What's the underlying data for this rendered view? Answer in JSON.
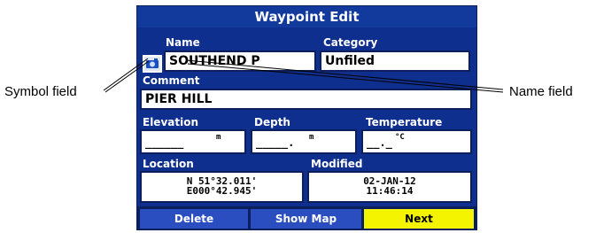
{
  "title": "Waypoint Edit",
  "labels": {
    "name": "Name",
    "category": "Category",
    "comment": "Comment",
    "elevation": "Elevation",
    "depth": "Depth",
    "temperature": "Temperature",
    "location": "Location",
    "modified": "Modified"
  },
  "values": {
    "name": "SOUTHEND P",
    "category": "Unfiled",
    "comment": "PIER HILL",
    "elevation": "______",
    "elevation_unit": "m",
    "depth": "_____.",
    "depth_unit": "m",
    "temperature": "__._",
    "temperature_unit": "°C",
    "location_lat": "N  51°32.011'",
    "location_lon": "E000°42.945'",
    "modified_date": "02-JAN-12",
    "modified_time": "11:46:14"
  },
  "buttons": {
    "delete": "Delete",
    "show_map": "Show Map",
    "next": "Next"
  },
  "callouts": {
    "symbol_field": "Symbol field",
    "name_field": "Name field"
  },
  "icons": {
    "symbol": "waypoint-symbol-icon"
  },
  "colors": {
    "background": "#0e2f8e",
    "active_button": "#f4f400"
  }
}
